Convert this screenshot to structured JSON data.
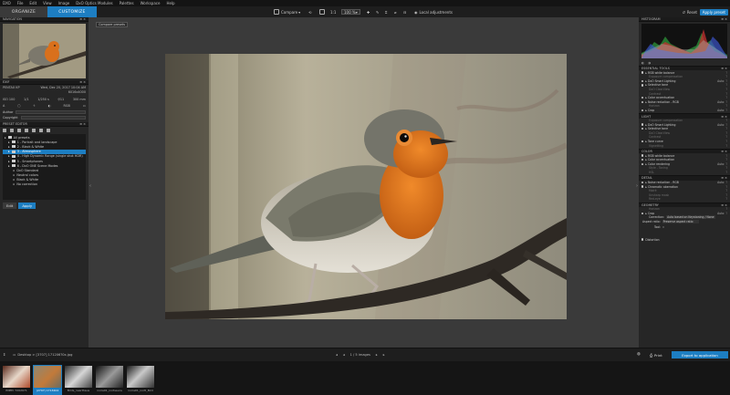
{
  "menu": [
    "DXO",
    "File",
    "Edit",
    "View",
    "Image",
    "DxO Optics Modules",
    "Palettes",
    "Workspace",
    "Help"
  ],
  "tabs": {
    "organize": "ORGANIZE",
    "customize": "CUSTOMIZE"
  },
  "toolbar": {
    "compare": "Compare",
    "zoom_fit": "1:1",
    "zoom_value": "100 %",
    "local_adjustments": "Local adjustments"
  },
  "top_right": {
    "reset": "Reset",
    "apply_preset": "Apply preset"
  },
  "left_panel": {
    "navigation_title": "NAVIGATION",
    "exif_title": "EXIF",
    "camera": "PENTAX KP",
    "date": "Wed, Dec 20, 2017 10:04 AM",
    "dimensions": "6016x4000",
    "exif_row": [
      "ISO 100",
      "1/1",
      "1/250 s",
      "f/11",
      "300 mm"
    ],
    "author_label": "Author",
    "copyright_label": "Copyright",
    "preset_editor_title": "PRESET EDITOR",
    "presets": [
      {
        "label": "All presets",
        "level": 0
      },
      {
        "label": "1 - Portrait and landscape",
        "level": 1
      },
      {
        "label": "2 - Black & White",
        "level": 1
      },
      {
        "label": "3 - Atmosphere",
        "level": 1,
        "selected": true
      },
      {
        "label": "4 - High Dynamic Range (single shot HDR)",
        "level": 1
      },
      {
        "label": "5 - Smartphones",
        "level": 1
      },
      {
        "label": "6 - DxO ONE Scene Modes",
        "level": 1
      },
      {
        "label": "DxO Standard",
        "level": 2
      },
      {
        "label": "Neutral colors",
        "level": 2
      },
      {
        "label": "Black & White",
        "level": 2
      },
      {
        "label": "No correction",
        "level": 2
      }
    ],
    "edit_label": "Edit",
    "apply_label": "Apply"
  },
  "center": {
    "compare_tooltip": "Compare presets"
  },
  "right_panel": {
    "histogram_title": "HISTOGRAM",
    "sections": [
      {
        "title": "ESSENTIAL TOOLS",
        "rows": [
          {
            "name": "RGB white balance",
            "val": "",
            "state": "on"
          },
          {
            "name": "Exposure compensation",
            "val": "",
            "state": "dim"
          },
          {
            "name": "DxO Smart Lighting",
            "val": "Auto",
            "state": "on"
          },
          {
            "name": "Selective tone",
            "val": "",
            "state": "on"
          },
          {
            "name": "DxO ClearView",
            "val": "",
            "state": "dim"
          },
          {
            "name": "Contrast",
            "val": "",
            "state": "dim"
          },
          {
            "name": "Color accentuation",
            "val": "",
            "state": "on"
          },
          {
            "name": "Noise reduction - RGB",
            "val": "Auto",
            "state": "on"
          },
          {
            "name": "Horizon",
            "val": "",
            "state": "dim"
          },
          {
            "name": "Crop",
            "val": "Auto",
            "state": "on"
          }
        ]
      },
      {
        "title": "LIGHT",
        "rows": [
          {
            "name": "Exposure compensation",
            "val": "",
            "state": "dim"
          },
          {
            "name": "DxO Smart Lighting",
            "val": "Auto",
            "state": "on"
          },
          {
            "name": "Selective tone",
            "val": "",
            "state": "on"
          },
          {
            "name": "DxO ClearView",
            "val": "",
            "state": "dim"
          },
          {
            "name": "Contrast",
            "val": "",
            "state": "dim"
          },
          {
            "name": "Tone curve",
            "val": "",
            "state": "on"
          },
          {
            "name": "Vignetting",
            "val": "",
            "state": "dim"
          }
        ]
      },
      {
        "title": "COLOR",
        "rows": [
          {
            "name": "RGB white balance",
            "val": "",
            "state": "on"
          },
          {
            "name": "Color accentuation",
            "val": "",
            "state": "on"
          },
          {
            "name": "Color rendering",
            "val": "Auto",
            "state": "on"
          },
          {
            "name": "Style - Toning",
            "val": "",
            "state": "dim"
          },
          {
            "name": "HSL",
            "val": "",
            "state": "dim"
          }
        ]
      },
      {
        "title": "DETAIL",
        "rows": [
          {
            "name": "Noise reduction - RGB",
            "val": "Auto",
            "state": "on"
          },
          {
            "name": "Chromatic aberration",
            "val": "",
            "state": "on"
          },
          {
            "name": "Moiré",
            "val": "",
            "state": "dim"
          },
          {
            "name": "Unsharp mask",
            "val": "",
            "state": "dim"
          },
          {
            "name": "Red-eye",
            "val": "",
            "state": "dim"
          }
        ]
      },
      {
        "title": "GEOMETRY",
        "rows": [
          {
            "name": "Horizon",
            "val": "",
            "state": "dim"
          },
          {
            "name": "Crop",
            "val": "Auto",
            "state": "on"
          }
        ]
      }
    ],
    "correction_label": "Correction:",
    "correction_value": "Auto based on Keystoning / None",
    "aspect_label": "Aspect ratio:",
    "aspect_value": "Preserve aspect ratio",
    "tool_label": "Tool:",
    "distortion": "Distortion"
  },
  "bottom": {
    "path": "Desktop > [3707] 171206?0x.jpg",
    "page_info": "1 / 5 images",
    "print": "Print",
    "export": "Export to application"
  },
  "filmstrip": [
    {
      "caption": "IMPPC 7202071",
      "selected": false
    },
    {
      "caption": "(2707) 1713404",
      "selected": true
    },
    {
      "caption": "Birds_nearthaus",
      "selected": false
    },
    {
      "caption": "noria01_nortsaura",
      "selected": false
    },
    {
      "caption": "noria01_nortl_Bird",
      "selected": false
    }
  ],
  "colors": {
    "accent": "#1d7ec2",
    "panel": "#262626",
    "canvas": "#3a3a3a"
  }
}
